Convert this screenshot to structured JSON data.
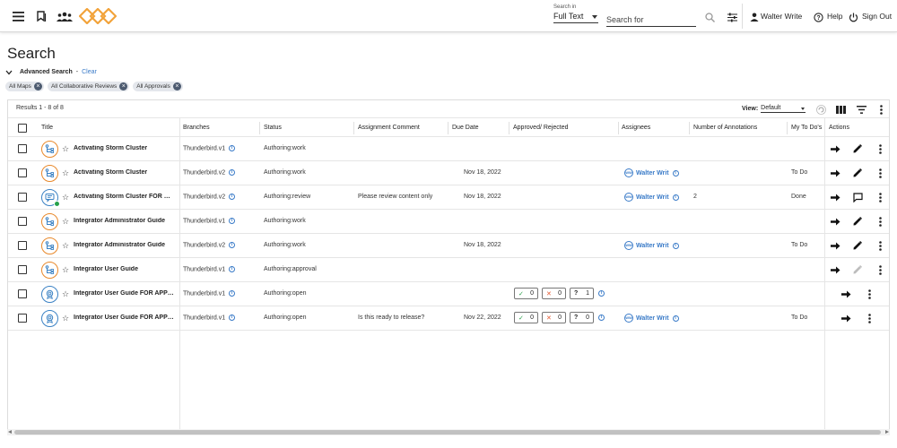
{
  "header": {
    "search_mode_label": "Search in",
    "search_mode_value": "Full Text",
    "search_placeholder": "Search for",
    "user_name": "Walter Write",
    "help_label": "Help",
    "signout_label": "Sign Out"
  },
  "page": {
    "title": "Search",
    "advanced_label": "Advanced Search",
    "separator": "-",
    "clear_label": "Clear",
    "filters": [
      "All Maps",
      "All Collaborative Reviews",
      "All Approvals"
    ]
  },
  "grid": {
    "results_text": "Results 1 - 8 of 8",
    "view_label": "View:",
    "view_value": "Default",
    "columns": {
      "title": "Title",
      "branches": "Branches",
      "status": "Status",
      "assignment_comment": "Assignment Comment",
      "due_date": "Due Date",
      "approved_rejected": "Approved/ Rejected",
      "assignees": "Assignees",
      "annotations": "Number of Annotations",
      "todos": "My To Do's",
      "actions": "Actions"
    },
    "rows": [
      {
        "icon": "map-icon",
        "title": "Activating Storm Cluster",
        "branch": "Thunderbird.v1",
        "status": "Authoring:work",
        "comment": "",
        "due": "",
        "assignee": "",
        "avatar": "",
        "annotations": "",
        "todo": "",
        "approvals": null,
        "action": "edit"
      },
      {
        "icon": "map-icon",
        "title": "Activating Storm Cluster",
        "branch": "Thunderbird.v2",
        "status": "Authoring:work",
        "comment": "",
        "due": "Nov 18, 2022",
        "assignee": "Walter Writ",
        "avatar": "WW",
        "annotations": "",
        "todo": "To Do",
        "approvals": null,
        "action": "edit"
      },
      {
        "icon": "review-icon",
        "title": "Activating Storm Cluster FOR RE...",
        "branch": "Thunderbird.v2",
        "status": "Authoring:review",
        "comment": "Please review content only",
        "due": "Nov 18, 2022",
        "assignee": "Walter Writ",
        "avatar": "WW",
        "annotations": "2",
        "todo": "Done",
        "approvals": null,
        "action": "comment"
      },
      {
        "icon": "map-icon",
        "title": "Integrator Administrator Guide",
        "branch": "Thunderbird.v1",
        "status": "Authoring:work",
        "comment": "",
        "due": "",
        "assignee": "",
        "avatar": "",
        "annotations": "",
        "todo": "",
        "approvals": null,
        "action": "edit"
      },
      {
        "icon": "map-icon",
        "title": "Integrator Administrator Guide",
        "branch": "Thunderbird.v2",
        "status": "Authoring:work",
        "comment": "",
        "due": "Nov 18, 2022",
        "assignee": "Walter Writ",
        "avatar": "WW",
        "annotations": "",
        "todo": "To Do",
        "approvals": null,
        "action": "edit"
      },
      {
        "icon": "map-icon",
        "title": "Integrator User Guide",
        "branch": "Thunderbird.v1",
        "status": "Authoring:approval",
        "comment": "",
        "due": "",
        "assignee": "",
        "avatar": "",
        "annotations": "",
        "todo": "",
        "approvals": null,
        "action": "edit-disabled"
      },
      {
        "icon": "approval-icon",
        "title": "Integrator User Guide FOR APPR...",
        "branch": "Thunderbird.v1",
        "status": "Authoring:open",
        "comment": "",
        "due": "",
        "assignee": "",
        "avatar": "",
        "annotations": "",
        "todo": "",
        "approvals": {
          "approved": "0",
          "rejected": "0",
          "pending": "1"
        },
        "action": "none"
      },
      {
        "icon": "approval-icon",
        "title": "Integrator User Guide FOR APPR...",
        "branch": "Thunderbird.v1",
        "status": "Authoring:open",
        "comment": "Is this ready to release?",
        "due": "Nov 22, 2022",
        "assignee": "Walter Writ",
        "avatar": "WW",
        "annotations": "",
        "todo": "To Do",
        "approvals": {
          "approved": "0",
          "rejected": "0",
          "pending": "0"
        },
        "action": "none"
      }
    ]
  },
  "colors": {
    "accent": "#3a7bc8",
    "map_icon_border": "#e8882a",
    "review_icon_border": "#3b82c4",
    "approved_green": "#2ca04c",
    "rejected_red": "#e4572e"
  }
}
